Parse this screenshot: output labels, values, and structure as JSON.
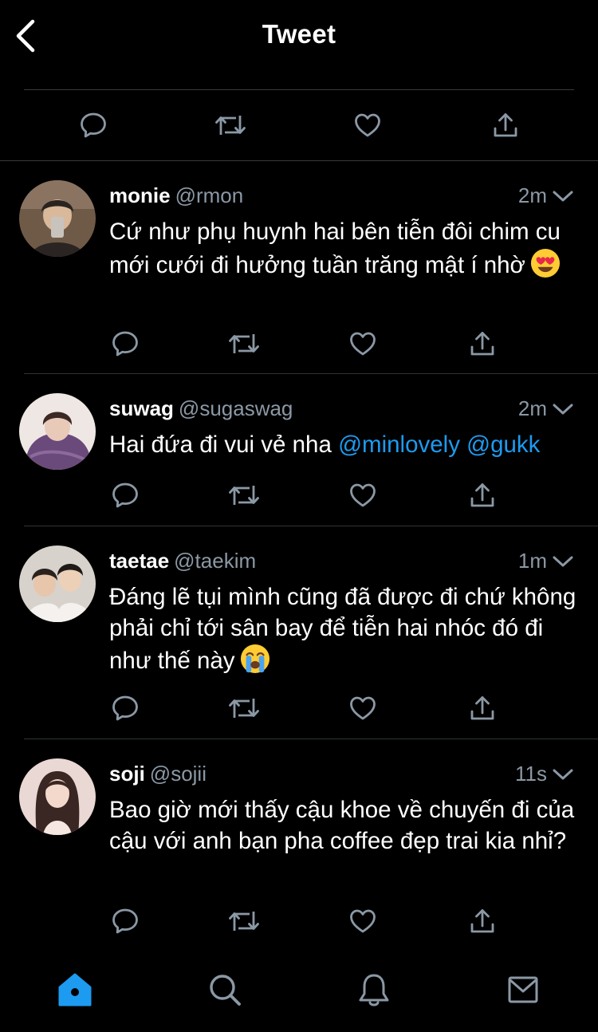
{
  "header": {
    "title": "Tweet"
  },
  "icons": {
    "back": "chevron-left-icon",
    "reply": "speech-bubble-icon",
    "retweet": "retweet-icon",
    "like": "heart-icon",
    "share": "share-upload-icon",
    "more": "chevron-down-icon",
    "home": "home-icon",
    "search": "search-icon",
    "notifications": "bell-icon",
    "messages": "envelope-icon"
  },
  "colors": {
    "background": "#000000",
    "text": "#ffffff",
    "secondary": "#8b98a5",
    "accent": "#1d9bf0",
    "divider": "#2f3336"
  },
  "replies": [
    {
      "name": "monie",
      "handle": "@rmon",
      "time": "2m",
      "text": "Cứ như phụ huynh hai bên tiễn đôi chim cu mới cưới đi hưởng tuần trăng mật í nhờ",
      "emoji": "heart-eyes-emoji"
    },
    {
      "name": "suwag",
      "handle": "@sugaswag",
      "time": "2m",
      "text": "Hai đứa đi vui vẻ nha ",
      "mention1": "@minlovely",
      "mention2": "@gukk"
    },
    {
      "name": "taetae",
      "handle": "@taekim",
      "time": "1m",
      "text": "Đáng lẽ tụi mình cũng đã được đi chứ không phải chỉ tới sân bay để tiễn hai nhóc đó đi như thế này",
      "emoji": "loudly-crying-emoji"
    },
    {
      "name": "soji",
      "handle": "@sojii",
      "time": "11s",
      "text": "Bao giờ mới thấy cậu khoe về chuyến đi của cậu với anh bạn pha coffee đẹp trai kia nhỉ?"
    }
  ],
  "tabbar": {
    "active": "home"
  }
}
